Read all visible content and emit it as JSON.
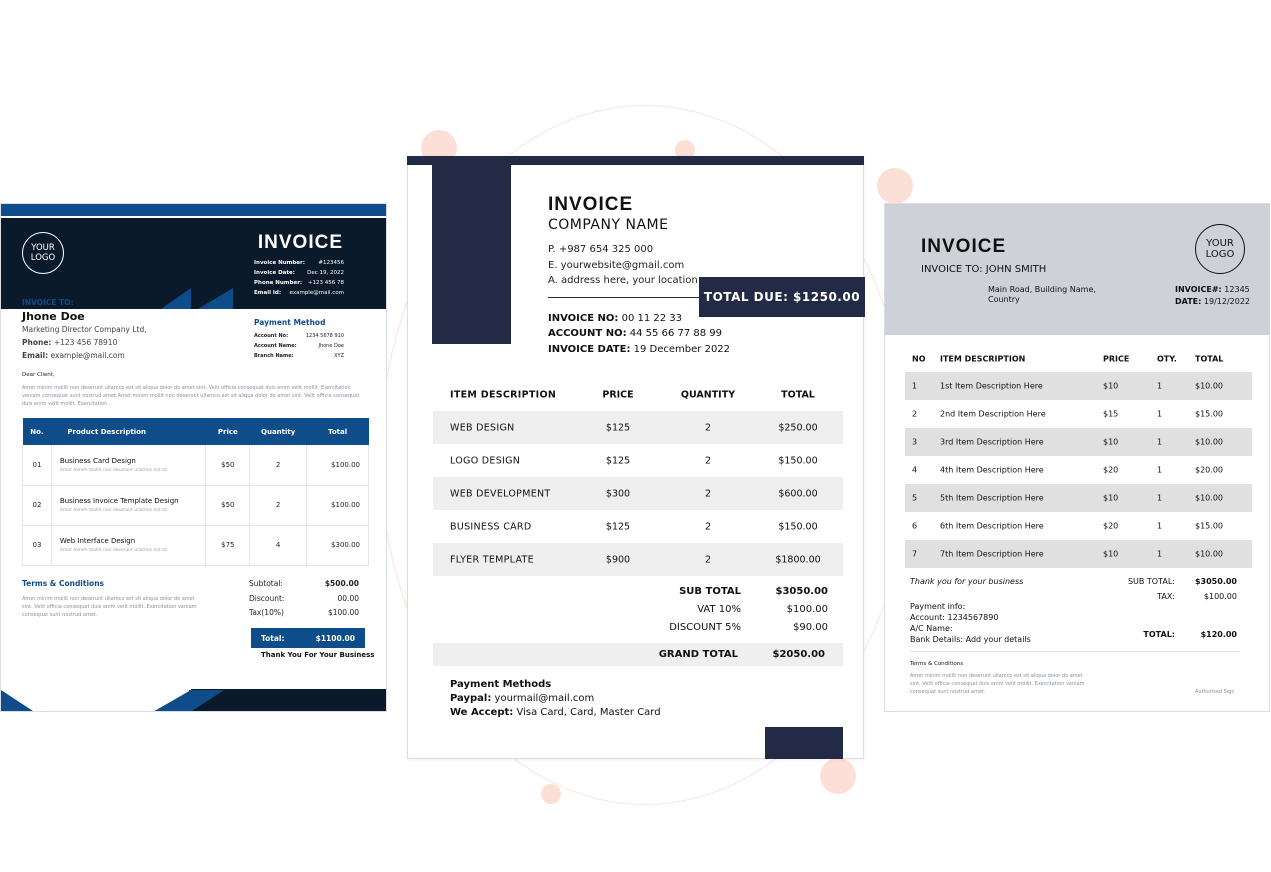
{
  "left": {
    "logo": "YOUR\nLOGO",
    "title": "INVOICE",
    "meta": [
      {
        "label": "Invoice Number:",
        "value": "#123456"
      },
      {
        "label": "Invoice Date:",
        "value": "Dec 19, 2022"
      },
      {
        "label": "Phone Number:",
        "value": "+123 456 78"
      },
      {
        "label": "Email Id:",
        "value": "example@mail.com"
      }
    ],
    "invoice_to": "INVOICE TO:",
    "client_name": "Jhone Doe",
    "client_company": "Marketing Director Company Ltd,",
    "phone_label": "Phone:",
    "phone": "+123 456 78910",
    "email_label": "Email:",
    "email": "example@mail.com",
    "payment_method_title": "Payment Method",
    "payment": [
      {
        "label": "Account No:",
        "value": "1234 5678 910"
      },
      {
        "label": "Account Name:",
        "value": "Jhone Doe"
      },
      {
        "label": "Branch Name:",
        "value": "XYZ"
      }
    ],
    "dear": "Dear Client,",
    "intro": "Amet minim mollit non deserunt ullamco est sit aliqua dolor do amet sint. Velit officia consequat duis enim velit mollit. Exercitation veniam consequat sunt nostrud amet.Amet minim mollit non deserunt ullamco est sit aliqua dolor do amet sint. Velit officia consequat duis enim velit mollit. Exercitation .",
    "columns": [
      "No.",
      "Product Description",
      "Price",
      "Quantity",
      "Total"
    ],
    "rows": [
      {
        "no": "01",
        "name": "Business Card Design",
        "sub": "Amet minim mollit non deserunt ullamco est sit.",
        "price": "$50",
        "qty": "2",
        "total": "$100.00"
      },
      {
        "no": "02",
        "name": "Business Invoice Template Design",
        "sub": "Amet minim mollit non deserunt ullamco est sit.",
        "price": "$50",
        "qty": "2",
        "total": "$100.00"
      },
      {
        "no": "03",
        "name": "Web Interface Design",
        "sub": "Amet minim mollit non deserunt ullamco est sit.",
        "price": "$75",
        "qty": "4",
        "total": "$300.00"
      }
    ],
    "terms_title": "Terms & Conditions",
    "terms_text": "Amet minim mollit non deserunt ullamco est sit aliqua dolor do amet sint. Velit officia consequat duis enim velit mollit. Exercitation veniam consequat sunt nostrud amet.",
    "subtotal_label": "Subtotal:",
    "subtotal": "$500.00",
    "discount_label": "Discount:",
    "discount": "00.00",
    "tax_label": "Tax(10%)",
    "tax": "$100.00",
    "total_label": "Total:",
    "total": "$1100.00",
    "thanks": "Thank You For Your Business"
  },
  "center": {
    "title": "INVOICE",
    "company": "COMPANY NAME",
    "phone": "P. +987 654 325 000",
    "email": "E. yourwebsite@gmail.com",
    "address": "A. address here, your location",
    "total_due": "TOTAL DUE: $1250.00",
    "invoice_no_label": "INVOICE NO:",
    "invoice_no": "00 11 22 33",
    "account_no_label": "ACCOUNT NO:",
    "account_no": "44 55 66 77 88 99",
    "invoice_date_label": "INVOICE DATE:",
    "invoice_date": "19 December 2022",
    "columns": [
      "ITEM DESCRIPTION",
      "PRICE",
      "QUANTITY",
      "TOTAL"
    ],
    "rows": [
      {
        "item": "WEB DESIGN",
        "price": "$125",
        "qty": "2",
        "total": "$250.00"
      },
      {
        "item": "LOGO DESIGN",
        "price": "$125",
        "qty": "2",
        "total": "$150.00"
      },
      {
        "item": "WEB DEVELOPMENT",
        "price": "$300",
        "qty": "2",
        "total": "$600.00"
      },
      {
        "item": "BUSINESS CARD",
        "price": "$125",
        "qty": "2",
        "total": "$150.00"
      },
      {
        "item": "FLYER TEMPLATE",
        "price": "$900",
        "qty": "2",
        "total": "$1800.00"
      }
    ],
    "sub_total_label": "SUB TOTAL",
    "sub_total": "$3050.00",
    "vat_label": "VAT 10%",
    "vat": "$100.00",
    "discount_label": "DISCOUNT 5%",
    "discount": "$90.00",
    "grand_total_label": "GRAND TOTAL",
    "grand_total": "$2050.00",
    "payment_title": "Payment Methods",
    "paypal_label": "Paypal:",
    "paypal": "yourmail@mail.com",
    "accept_label": "We Accept:",
    "accept": "Visa Card, Card, Master Card"
  },
  "right": {
    "title": "INVOICE",
    "invoice_to": "INVOICE TO: JOHN SMITH",
    "address": "Main Road, Building Name, Country",
    "logo": "YOUR\nLOGO",
    "invoice_no_label": "INVOICE#:",
    "invoice_no": "12345",
    "date_label": "DATE:",
    "date": "19/12/2022",
    "columns": [
      "NO",
      "ITEM DESCRIPTION",
      "PRICE",
      "OTY.",
      "TOTAL"
    ],
    "rows": [
      {
        "no": "1",
        "desc": "1st Item Description Here",
        "price": "$10",
        "qty": "1",
        "total": "$10.00"
      },
      {
        "no": "2",
        "desc": "2nd Item Description Here",
        "price": "$15",
        "qty": "1",
        "total": "$15.00"
      },
      {
        "no": "3",
        "desc": "3rd Item Description Here",
        "price": "$10",
        "qty": "1",
        "total": "$10.00"
      },
      {
        "no": "4",
        "desc": "4th Item Description Here",
        "price": "$20",
        "qty": "1",
        "total": "$20.00"
      },
      {
        "no": "5",
        "desc": "5th Item Description Here",
        "price": "$10",
        "qty": "1",
        "total": "$10.00"
      },
      {
        "no": "6",
        "desc": "6th Item Description Here",
        "price": "$20",
        "qty": "1",
        "total": "$15.00"
      },
      {
        "no": "7",
        "desc": "7th Item Description Here",
        "price": "$10",
        "qty": "1",
        "total": "$10.00"
      }
    ],
    "thanks": "Thank you for your business",
    "sub_total_label": "SUB TOTAL:",
    "sub_total": "$3050.00",
    "tax_label": "TAX:",
    "tax": "$100.00",
    "total_label": "TOTAL:",
    "total": "$120.00",
    "payment_info": "Payment info:",
    "account": "Account: 1234567890",
    "ac_name": "A/C Name:",
    "bank": "Bank Details: Add your details",
    "terms_title": "Terms & Conditions",
    "terms_text": "Amet minim mollit non deserunt ullamco est sit aliqua dolor do amet sint. Velit officia consequat duis enim velit mollit. Exercitation veniam consequat sunt nostrud amet.",
    "sign": "Authorised Sign"
  },
  "colors": {
    "navy": "#232a45",
    "blue": "#0f4c8a",
    "dark": "#0b1a2b",
    "grey_header": "#ced1d8",
    "peach": "#fcdfd6"
  }
}
